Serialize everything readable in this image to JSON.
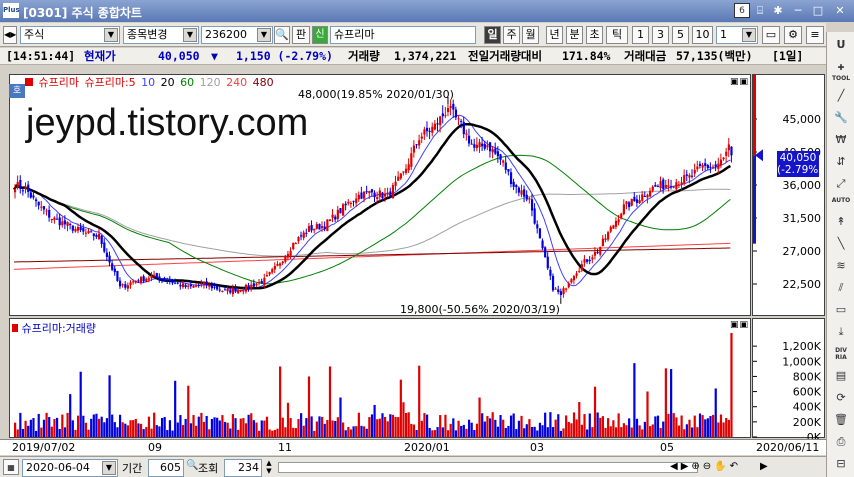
{
  "window": {
    "logo": "Plus",
    "title": "[0301] 주식 종합차트",
    "page_num": "6",
    "controls": [
      "⌸",
      "✱",
      "─",
      "□",
      "✕"
    ]
  },
  "toolbar": {
    "market": "주식",
    "change_label": "종목변경",
    "code": "236200",
    "ref_button": "판",
    "stock_badge": "신",
    "stock_name": "슈프리마",
    "periods": [
      "일",
      "주",
      "월",
      "년",
      "분",
      "초",
      "틱"
    ],
    "period_active": "일",
    "intervals": [
      "1",
      "3",
      "5",
      "10"
    ],
    "interval_value": "1"
  },
  "infobar": {
    "time": "[14:51:44]",
    "price_label": "현재가",
    "price": "40,050",
    "change_arrow": "▼",
    "change": "1,150 (-2.79%)",
    "volume_label": "거래량",
    "volume": "1,374,221",
    "prev_ratio_label": "전일거래량대비",
    "prev_ratio": "171.84%",
    "amount_label": "거래대금",
    "amount": "57,135(백만)",
    "period_tag": "[1일]"
  },
  "watermark": "jeypd.tistory.com",
  "legend": {
    "toggle_label": "호",
    "items": [
      {
        "text": "슈프리마",
        "color": "#e00000"
      },
      {
        "text": "슈프리마:5",
        "color": "#e00000"
      },
      {
        "text": "10",
        "color": "#4040ff"
      },
      {
        "text": "20",
        "color": "#000000"
      },
      {
        "text": "60",
        "color": "#008000"
      },
      {
        "text": "120",
        "color": "#a0a0a0"
      },
      {
        "text": "240",
        "color": "#ff4040"
      },
      {
        "text": "480",
        "color": "#800000"
      }
    ]
  },
  "volume_legend": "슈프리마:거래량",
  "annotations": {
    "high": "48,000(19.85% 2020/01/30)",
    "low": "19,800(-50.56% 2020/03/19)"
  },
  "price_axis": {
    "ticks": [
      "45,000",
      "40,500",
      "36,000",
      "31,500",
      "27,000",
      "22,500"
    ],
    "current_price": "40,050",
    "current_change": "(-2.79%)"
  },
  "volume_axis": {
    "ticks": [
      "1,200K",
      "1,000K",
      "800K",
      "600K",
      "400K",
      "200K",
      "0K"
    ]
  },
  "date_axis": {
    "labels": [
      "2019/07/02",
      "09",
      "11",
      "2020/01",
      "03",
      "05",
      "2020/06/11"
    ]
  },
  "bottom": {
    "date": "2020-06-04",
    "period_label": "기간",
    "period_value": "605",
    "view_label": "조회",
    "view_value": "234"
  },
  "sidebar": {
    "items": [
      "U",
      "TOOL",
      "AUTO",
      "DIV RIA"
    ]
  },
  "colors": {
    "up": "#e00000",
    "down": "#0000e0",
    "ma10": "#4040ff",
    "ma20": "#000000",
    "ma60": "#008000",
    "ma120": "#a0a0a0",
    "ma240": "#ff4040",
    "ma480": "#800000"
  },
  "chart_data": {
    "type": "candlestick",
    "ylim": [
      18000,
      51000
    ],
    "volume_ylim": [
      0,
      1400000
    ],
    "high_point": {
      "date": "2020/01/30",
      "value": 48000
    },
    "low_point": {
      "date": "2020/03/19",
      "value": 19800
    },
    "last_close": 40050,
    "last_volume": 1374221,
    "anchors": [
      {
        "t": 0,
        "v": 36000
      },
      {
        "t": 4,
        "v": 35500
      },
      {
        "t": 8,
        "v": 33500
      },
      {
        "t": 14,
        "v": 31500
      },
      {
        "t": 20,
        "v": 30500
      },
      {
        "t": 26,
        "v": 29500
      },
      {
        "t": 32,
        "v": 29000
      },
      {
        "t": 36,
        "v": 25500
      },
      {
        "t": 40,
        "v": 22000
      },
      {
        "t": 46,
        "v": 23000
      },
      {
        "t": 52,
        "v": 23500
      },
      {
        "t": 58,
        "v": 23000
      },
      {
        "t": 66,
        "v": 22000
      },
      {
        "t": 72,
        "v": 22500
      },
      {
        "t": 80,
        "v": 21500
      },
      {
        "t": 88,
        "v": 22000
      },
      {
        "t": 95,
        "v": 23000
      },
      {
        "t": 100,
        "v": 25000
      },
      {
        "t": 106,
        "v": 28000
      },
      {
        "t": 112,
        "v": 30000
      },
      {
        "t": 118,
        "v": 30500
      },
      {
        "t": 124,
        "v": 32500
      },
      {
        "t": 130,
        "v": 34500
      },
      {
        "t": 136,
        "v": 35000
      },
      {
        "t": 142,
        "v": 34500
      },
      {
        "t": 148,
        "v": 37500
      },
      {
        "t": 154,
        "v": 42500
      },
      {
        "t": 160,
        "v": 44000
      },
      {
        "t": 165,
        "v": 46500
      },
      {
        "t": 170,
        "v": 44000
      },
      {
        "t": 175,
        "v": 41000
      },
      {
        "t": 180,
        "v": 41500
      },
      {
        "t": 186,
        "v": 39000
      },
      {
        "t": 190,
        "v": 36000
      },
      {
        "t": 196,
        "v": 34000
      },
      {
        "t": 201,
        "v": 27000
      },
      {
        "t": 205,
        "v": 22000
      },
      {
        "t": 208,
        "v": 21000
      },
      {
        "t": 212,
        "v": 23500
      },
      {
        "t": 217,
        "v": 25500
      },
      {
        "t": 222,
        "v": 27000
      },
      {
        "t": 227,
        "v": 30000
      },
      {
        "t": 232,
        "v": 33000
      },
      {
        "t": 237,
        "v": 34000
      },
      {
        "t": 242,
        "v": 35500
      },
      {
        "t": 247,
        "v": 36000
      },
      {
        "t": 252,
        "v": 36500
      },
      {
        "t": 257,
        "v": 37000
      },
      {
        "t": 262,
        "v": 38500
      },
      {
        "t": 267,
        "v": 38500
      },
      {
        "t": 270,
        "v": 39500
      },
      {
        "t": 272,
        "v": 41200
      },
      {
        "t": 273,
        "v": 40050
      }
    ]
  }
}
